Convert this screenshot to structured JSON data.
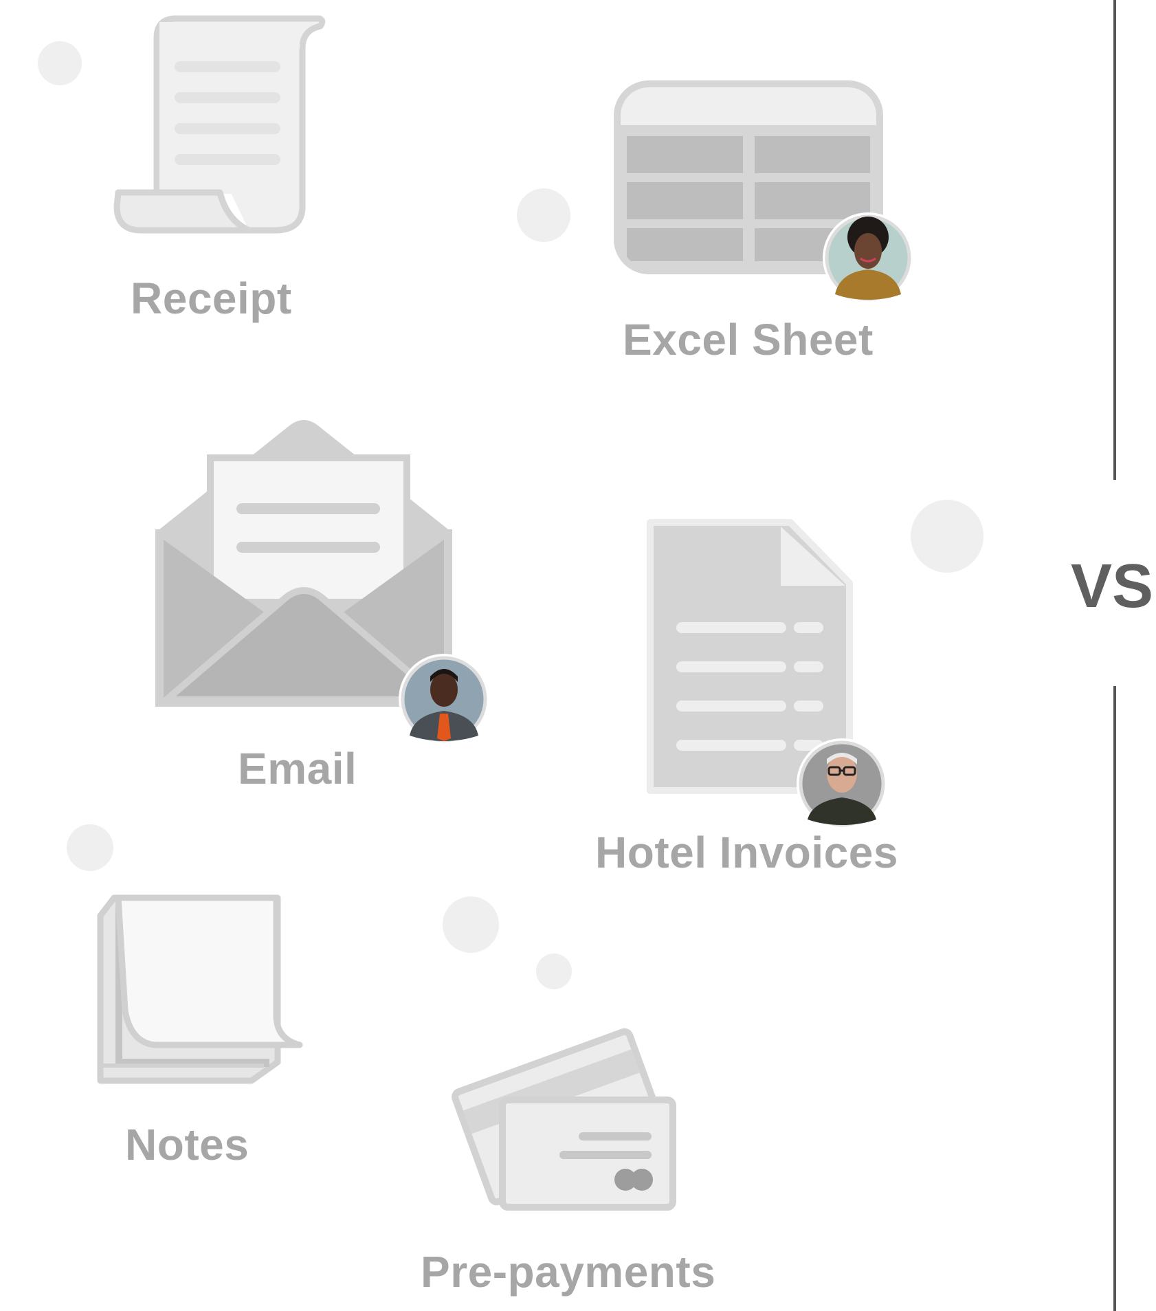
{
  "items": [
    {
      "key": "receipt",
      "label": "Receipt",
      "icon": "receipt-icon",
      "has_avatar": false
    },
    {
      "key": "excel",
      "label": "Excel Sheet",
      "icon": "spreadsheet-icon",
      "has_avatar": true,
      "avatar": "avatar-woman"
    },
    {
      "key": "email",
      "label": "Email",
      "icon": "envelope-icon",
      "has_avatar": true,
      "avatar": "avatar-man-tie"
    },
    {
      "key": "hotel",
      "label": "Hotel Invoices",
      "icon": "invoice-document-icon",
      "has_avatar": true,
      "avatar": "avatar-man-glasses"
    },
    {
      "key": "notes",
      "label": "Notes",
      "icon": "sticky-notes-icon",
      "has_avatar": false
    },
    {
      "key": "prepay",
      "label": "Pre-payments",
      "icon": "credit-cards-icon",
      "has_avatar": false
    }
  ],
  "divider": {
    "label": "VS"
  },
  "colors": {
    "icon_light": "#e9e9e9",
    "icon_mid": "#d2d2d2",
    "icon_dark": "#b9b9b9",
    "label": "#a6a6a6",
    "vs_text": "#5f5f5f",
    "divider_line": "#555555",
    "bubble": "#efefef"
  }
}
